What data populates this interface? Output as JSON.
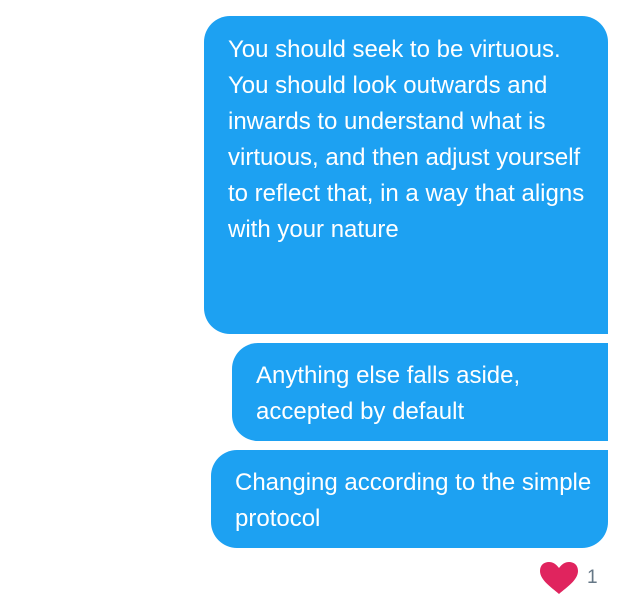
{
  "messages": [
    {
      "text": "You should seek to be virtuous. You should look outwards and inwards to understand what is virtuous, and then adjust yourself to reflect that, in a way that aligns with your nature"
    },
    {
      "text": "Anything else falls aside, accepted by default"
    },
    {
      "text": "Changing according to the simple protocol"
    }
  ],
  "reaction": {
    "icon": "heart-icon",
    "count": "1"
  },
  "colors": {
    "bubble": "#1da1f2",
    "bubble_text": "#ffffff",
    "heart": "#e0245e",
    "count": "#657786",
    "background": "#ffffff"
  }
}
